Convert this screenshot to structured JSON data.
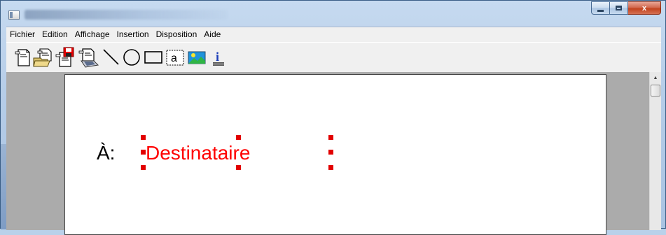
{
  "window": {
    "title": "",
    "min_label": "",
    "max_label": "",
    "close_label": "x"
  },
  "menu": [
    "Fichier",
    "Edition",
    "Affichage",
    "Insertion",
    "Disposition",
    "Aide"
  ],
  "toolbar": {
    "icons": [
      "new-document-icon",
      "open-folder-icon",
      "save-icon",
      "print-icon",
      "line-tool-icon",
      "ellipse-tool-icon",
      "rectangle-tool-icon",
      "text-tool-icon",
      "image-tool-icon",
      "info-icon"
    ],
    "text_tool_glyph": "a",
    "info_glyph": "i"
  },
  "document": {
    "label": "À:",
    "field": "Destinataire"
  },
  "colors": {
    "field_text": "#ff0000",
    "handles": "#e20000",
    "page": "#ffffff",
    "workspace": "#ababab"
  }
}
